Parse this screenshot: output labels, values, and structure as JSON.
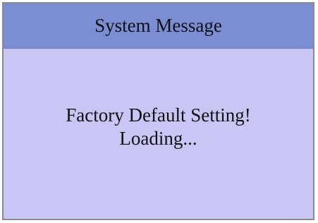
{
  "dialog": {
    "title": "System Message",
    "message_line_1": "Factory Default Setting!",
    "message_line_2": "Loading..."
  },
  "colors": {
    "title_bar": "#7b8ed3",
    "body": "#c9c6f5",
    "border": "#8a8a8a",
    "text": "#111111"
  }
}
